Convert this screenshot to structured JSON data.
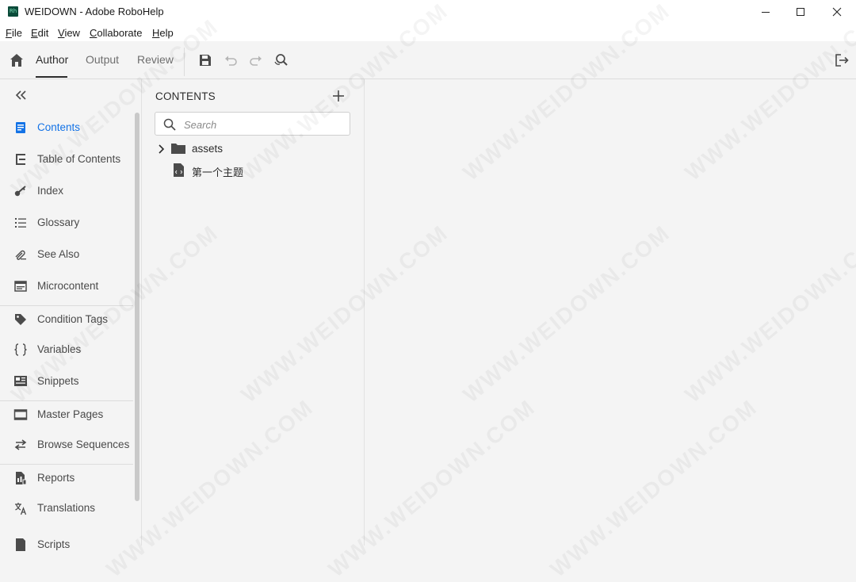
{
  "window": {
    "app_icon_text": "Rh",
    "title": "WEIDOWN - Adobe RoboHelp"
  },
  "menu": [
    {
      "pre": "",
      "u": "F",
      "post": "ile"
    },
    {
      "pre": "",
      "u": "E",
      "post": "dit"
    },
    {
      "pre": "",
      "u": "V",
      "post": "iew"
    },
    {
      "pre": "",
      "u": "C",
      "post": "ollaborate"
    },
    {
      "pre": "",
      "u": "H",
      "post": "elp"
    }
  ],
  "tabs": {
    "author": "Author",
    "output": "Output",
    "review": "Review"
  },
  "sidebar": {
    "items": [
      {
        "label": "Contents",
        "icon": "contents-icon",
        "active": true
      },
      {
        "label": "Table of Contents",
        "icon": "toc-icon"
      },
      {
        "label": "Index",
        "icon": "key-icon"
      },
      {
        "label": "Glossary",
        "icon": "glossary-icon"
      },
      {
        "label": "See Also",
        "icon": "see-also-icon"
      },
      {
        "label": "Microcontent",
        "icon": "microcontent-icon"
      },
      {
        "label": "Condition Tags",
        "icon": "tag-icon"
      },
      {
        "label": "Variables",
        "icon": "braces-icon"
      },
      {
        "label": "Snippets",
        "icon": "snippets-icon"
      },
      {
        "label": "Master Pages",
        "icon": "master-pages-icon"
      },
      {
        "label": "Browse Sequences",
        "icon": "arrows-icon"
      },
      {
        "label": "Reports",
        "icon": "reports-icon"
      },
      {
        "label": "Translations",
        "icon": "translate-icon"
      },
      {
        "label": "Scripts",
        "icon": "scripts-icon"
      }
    ]
  },
  "panel": {
    "title": "CONTENTS",
    "search_placeholder": "Search",
    "tree": [
      {
        "label": "assets",
        "type": "folder"
      },
      {
        "label": "第一个主题",
        "type": "topic"
      }
    ]
  },
  "watermark": "WWW.WEIDOWN.COM",
  "colors": {
    "accent": "#1473e6",
    "app_icon_bg": "#0b4b3a"
  }
}
